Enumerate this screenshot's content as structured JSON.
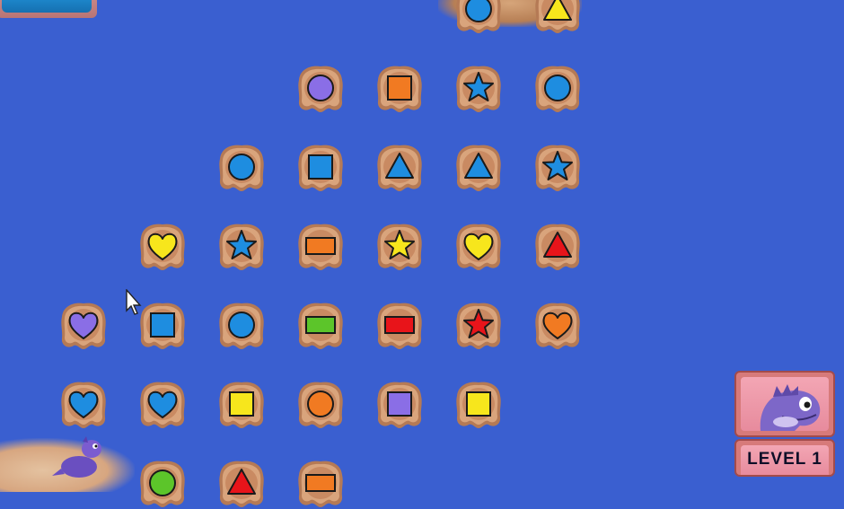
{
  "hud": {
    "level_label": "LEVEL 1"
  },
  "colors": {
    "water": "#3a5fd0",
    "tile": "#c98a62",
    "red": "#e8141a",
    "blue": "#1e8de0",
    "yellow": "#f7e61c",
    "purple": "#8a6ee6",
    "orange": "#f17a22",
    "green": "#5cc52a"
  },
  "tiles": [
    {
      "row": 0,
      "col": 6,
      "shape": "circle",
      "color": "blue"
    },
    {
      "row": 0,
      "col": 7,
      "shape": "triangle",
      "color": "yellow"
    },
    {
      "row": 1,
      "col": 4,
      "shape": "circle",
      "color": "purple"
    },
    {
      "row": 1,
      "col": 5,
      "shape": "square",
      "color": "orange"
    },
    {
      "row": 1,
      "col": 6,
      "shape": "star",
      "color": "blue"
    },
    {
      "row": 1,
      "col": 7,
      "shape": "circle",
      "color": "blue"
    },
    {
      "row": 2,
      "col": 3,
      "shape": "circle",
      "color": "blue"
    },
    {
      "row": 2,
      "col": 4,
      "shape": "square",
      "color": "blue"
    },
    {
      "row": 2,
      "col": 5,
      "shape": "triangle",
      "color": "blue"
    },
    {
      "row": 2,
      "col": 6,
      "shape": "triangle",
      "color": "blue"
    },
    {
      "row": 2,
      "col": 7,
      "shape": "star",
      "color": "blue"
    },
    {
      "row": 3,
      "col": 2,
      "shape": "heart",
      "color": "yellow"
    },
    {
      "row": 3,
      "col": 3,
      "shape": "star",
      "color": "blue"
    },
    {
      "row": 3,
      "col": 4,
      "shape": "rectangle",
      "color": "orange"
    },
    {
      "row": 3,
      "col": 5,
      "shape": "star",
      "color": "yellow"
    },
    {
      "row": 3,
      "col": 6,
      "shape": "heart",
      "color": "yellow"
    },
    {
      "row": 3,
      "col": 7,
      "shape": "triangle",
      "color": "red"
    },
    {
      "row": 4,
      "col": 1,
      "shape": "heart",
      "color": "purple"
    },
    {
      "row": 4,
      "col": 2,
      "shape": "square",
      "color": "blue"
    },
    {
      "row": 4,
      "col": 3,
      "shape": "circle",
      "color": "blue"
    },
    {
      "row": 4,
      "col": 4,
      "shape": "rectangle",
      "color": "green"
    },
    {
      "row": 4,
      "col": 5,
      "shape": "rectangle",
      "color": "red"
    },
    {
      "row": 4,
      "col": 6,
      "shape": "star",
      "color": "red"
    },
    {
      "row": 4,
      "col": 7,
      "shape": "heart",
      "color": "orange"
    },
    {
      "row": 5,
      "col": 1,
      "shape": "heart",
      "color": "blue"
    },
    {
      "row": 5,
      "col": 2,
      "shape": "heart",
      "color": "blue"
    },
    {
      "row": 5,
      "col": 3,
      "shape": "square",
      "color": "yellow"
    },
    {
      "row": 5,
      "col": 4,
      "shape": "circle",
      "color": "orange"
    },
    {
      "row": 5,
      "col": 5,
      "shape": "square",
      "color": "purple"
    },
    {
      "row": 5,
      "col": 6,
      "shape": "square",
      "color": "yellow"
    },
    {
      "row": 6,
      "col": 2,
      "shape": "circle",
      "color": "green"
    },
    {
      "row": 6,
      "col": 3,
      "shape": "triangle",
      "color": "red"
    },
    {
      "row": 6,
      "col": 4,
      "shape": "rectangle",
      "color": "orange"
    }
  ]
}
